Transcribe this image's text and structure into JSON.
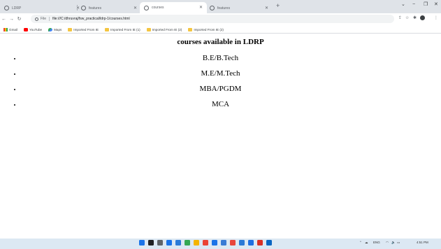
{
  "browser": {
    "tabs": [
      {
        "label": "LDRP",
        "active": false
      },
      {
        "label": "features",
        "active": false
      },
      {
        "label": "courses",
        "active": true
      },
      {
        "label": "features",
        "active": false
      }
    ],
    "address": {
      "scheme": "File",
      "url": "file:///C:/dhruvraj/fsw_practical/ldrp-1/courses.html"
    },
    "bookmarks": [
      {
        "label": "Gmail",
        "icon": "gmail-icon"
      },
      {
        "label": "YouTube",
        "icon": "youtube-icon"
      },
      {
        "label": "Maps",
        "icon": "maps-icon"
      },
      {
        "label": "Imported From IE",
        "icon": "folder-icon"
      },
      {
        "label": "Imported From IE (1)",
        "icon": "folder-icon"
      },
      {
        "label": "Imported From IE (2)",
        "icon": "folder-icon"
      },
      {
        "label": "Imported From IE (2)",
        "icon": "folder-icon"
      }
    ]
  },
  "page": {
    "title": "courses available in LDRP",
    "courses": [
      "B.E/B.Tech",
      "M.E/M.Tech",
      "MBA/PGDM",
      "MCA"
    ]
  },
  "taskbar": {
    "language": "ENG",
    "time": "4:51 PM",
    "icon_colors": [
      "#1a73e8",
      "#202124",
      "#5f6368",
      "#1a73e8",
      "#2b7bd8",
      "#34a853",
      "#f4b400",
      "#ea4335",
      "#1a73e8",
      "#3a7bd5",
      "#e8453c",
      "#2b79d6",
      "#1f6fe0",
      "#d93025",
      "#0a66c2"
    ]
  }
}
